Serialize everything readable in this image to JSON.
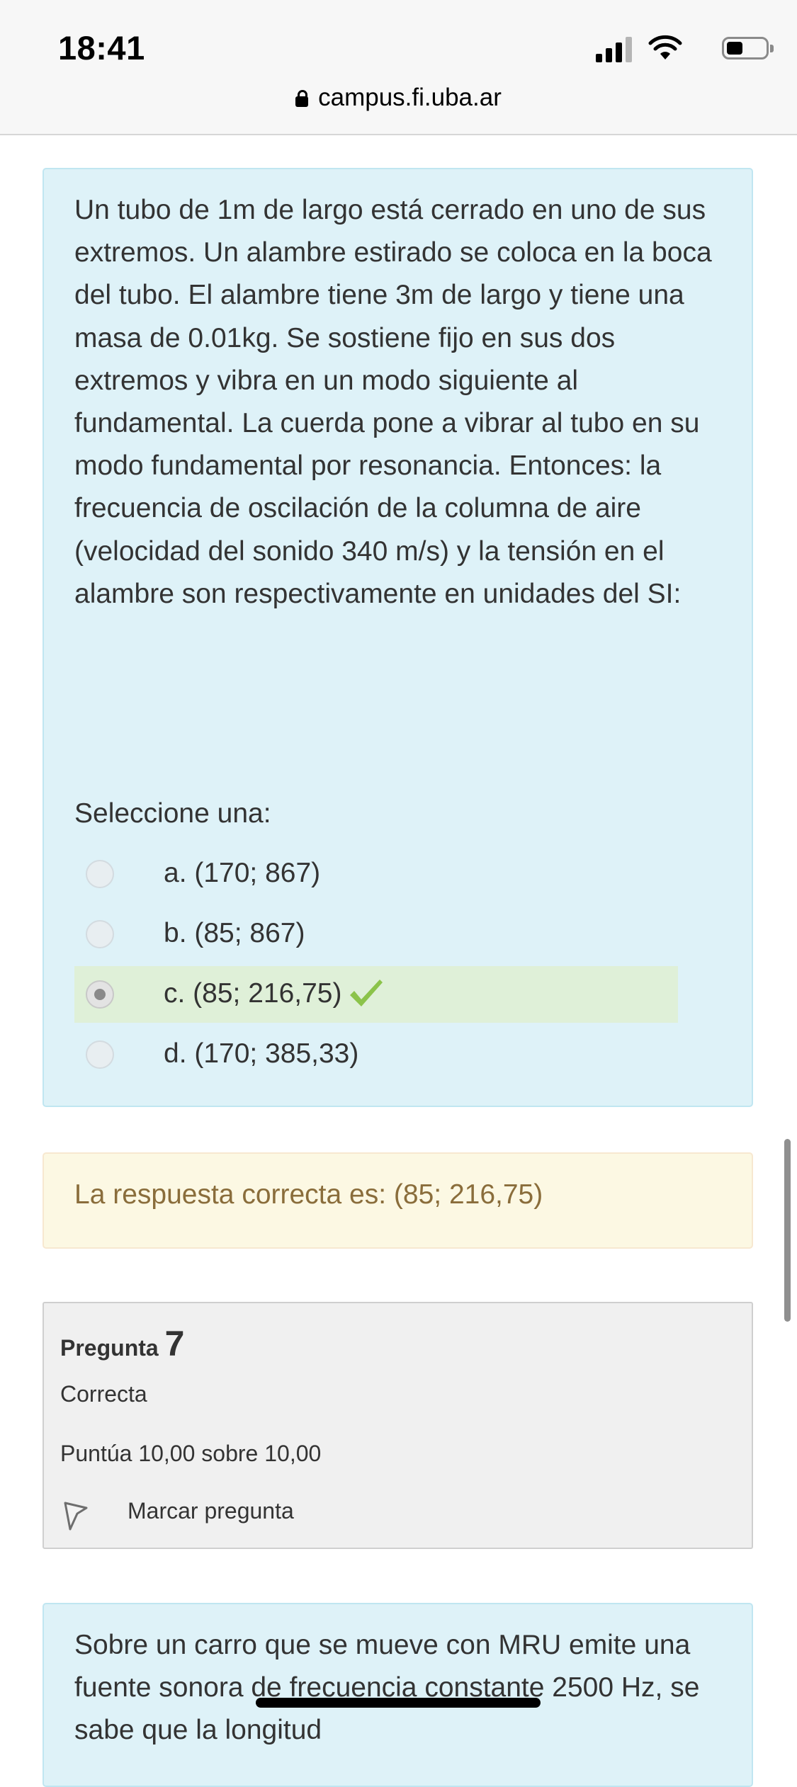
{
  "status_bar": {
    "time": "18:41",
    "icons": [
      "signal-icon",
      "wifi-icon",
      "battery-icon"
    ]
  },
  "address_bar": {
    "url": "campus.fi.uba.ar",
    "icon": "lock-icon"
  },
  "question": {
    "text": "Un tubo de 1m de largo está cerrado en uno de sus extremos. Un alambre estirado se coloca en la boca del tubo. El alambre tiene 3m de largo y tiene una masa de 0.01kg. Se sostiene fijo en sus dos extremos y vibra en un modo siguiente al fundamental. La cuerda pone a vibrar al tubo en su modo fundamental por resonancia. Entonces: la frecuencia de oscilación de la columna de aire (velocidad del sonido 340 m/s) y la tensión en el alambre son respectivamente en unidades del SI:",
    "select_label": "Seleccione una:",
    "options": [
      {
        "label": "a. (170; 867)",
        "selected": false,
        "correct": false
      },
      {
        "label": "b. (85; 867)",
        "selected": false,
        "correct": false
      },
      {
        "label": "c. (85; 216,75)",
        "selected": true,
        "correct": true
      },
      {
        "label": "d. (170; 385,33)",
        "selected": false,
        "correct": false
      }
    ]
  },
  "feedback": {
    "text": "La respuesta correcta es: (85; 216,75)"
  },
  "question_info": {
    "title_prefix": "Pregunta",
    "number": "7",
    "state": "Correcta",
    "grade": "Puntúa 10,00 sobre 10,00",
    "flag_label": "Marcar pregunta"
  },
  "next_question": {
    "text": "Sobre un carro que se mueve con MRU emite una fuente sonora de frecuencia constante 2500 Hz, se sabe que la longitud"
  },
  "colors": {
    "question_bg": "#def2f8",
    "correct_bg": "#dff0d8",
    "check": "#7cb342",
    "feedback_bg": "#fcf8e3",
    "feedback_text": "#8a6d3b",
    "info_bg": "#f0f0f0"
  }
}
